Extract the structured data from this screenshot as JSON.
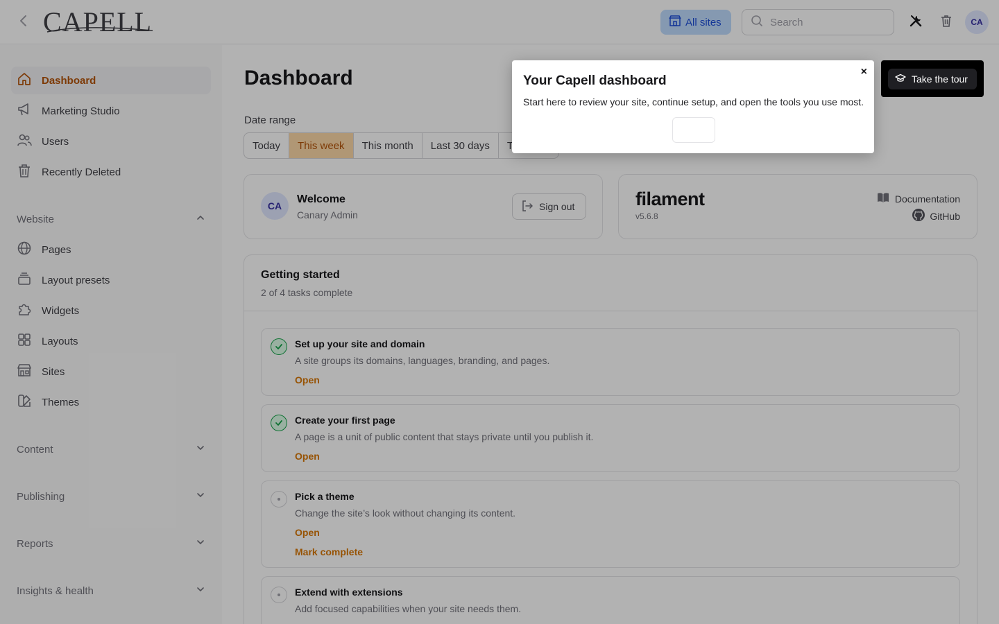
{
  "topbar": {
    "logo_text": "CAPELL",
    "all_sites_label": "All sites",
    "search_placeholder": "Search",
    "avatar_initials": "CA"
  },
  "sidebar": {
    "items": [
      {
        "label": "Dashboard",
        "icon": "home-icon",
        "active": true
      },
      {
        "label": "Marketing Studio",
        "icon": "megaphone-icon"
      },
      {
        "label": "Users",
        "icon": "users-icon"
      },
      {
        "label": "Recently Deleted",
        "icon": "trash-icon"
      }
    ],
    "website_group": {
      "label": "Website",
      "expanded": true,
      "items": [
        {
          "label": "Pages",
          "icon": "globe-icon"
        },
        {
          "label": "Layout presets",
          "icon": "stack-icon"
        },
        {
          "label": "Widgets",
          "icon": "puzzle-icon"
        },
        {
          "label": "Layouts",
          "icon": "grid-icon"
        },
        {
          "label": "Sites",
          "icon": "building-icon"
        },
        {
          "label": "Themes",
          "icon": "swatch-icon"
        }
      ]
    },
    "collapsed_groups": [
      {
        "label": "Content"
      },
      {
        "label": "Publishing"
      },
      {
        "label": "Reports"
      },
      {
        "label": "Insights & health"
      }
    ]
  },
  "main": {
    "title": "Dashboard",
    "date_range": {
      "label": "Date range",
      "options": [
        "Today",
        "This week",
        "This month",
        "Last 30 days",
        "T"
      ],
      "selected": "This week"
    },
    "welcome": {
      "initials": "CA",
      "title": "Welcome",
      "name": "Canary Admin",
      "sign_out_label": "Sign out"
    },
    "filament": {
      "logo": "filament",
      "version": "v5.6.8",
      "documentation_label": "Documentation",
      "github_label": "GitHub"
    },
    "getting_started": {
      "title": "Getting started",
      "progress": "2 of 4 tasks complete",
      "tasks": [
        {
          "title": "Set up your site and domain",
          "description": "A site groups its domains, languages, branding, and pages.",
          "done": true,
          "links": [
            "Open"
          ]
        },
        {
          "title": "Create your first page",
          "description": "A page is a unit of public content that stays private until you publish it.",
          "done": true,
          "links": [
            "Open"
          ]
        },
        {
          "title": "Pick a theme",
          "description": "Change the site’s look without changing its content.",
          "done": false,
          "links": [
            "Open",
            "Mark complete"
          ]
        },
        {
          "title": "Extend with extensions",
          "description": "Add focused capabilities when your site needs them.",
          "done": false,
          "links": []
        }
      ]
    }
  },
  "tour": {
    "title": "Your Capell dashboard",
    "description": "Start here to review your site, continue setup, and open the tools you use most.",
    "close_symbol": "×",
    "take_tour_label": "Take the tour"
  },
  "colors": {
    "accent": "#d97706",
    "active_segment": "#fcd9a8",
    "all_sites_bg": "#bfdbfe",
    "success": "#16a34a"
  }
}
